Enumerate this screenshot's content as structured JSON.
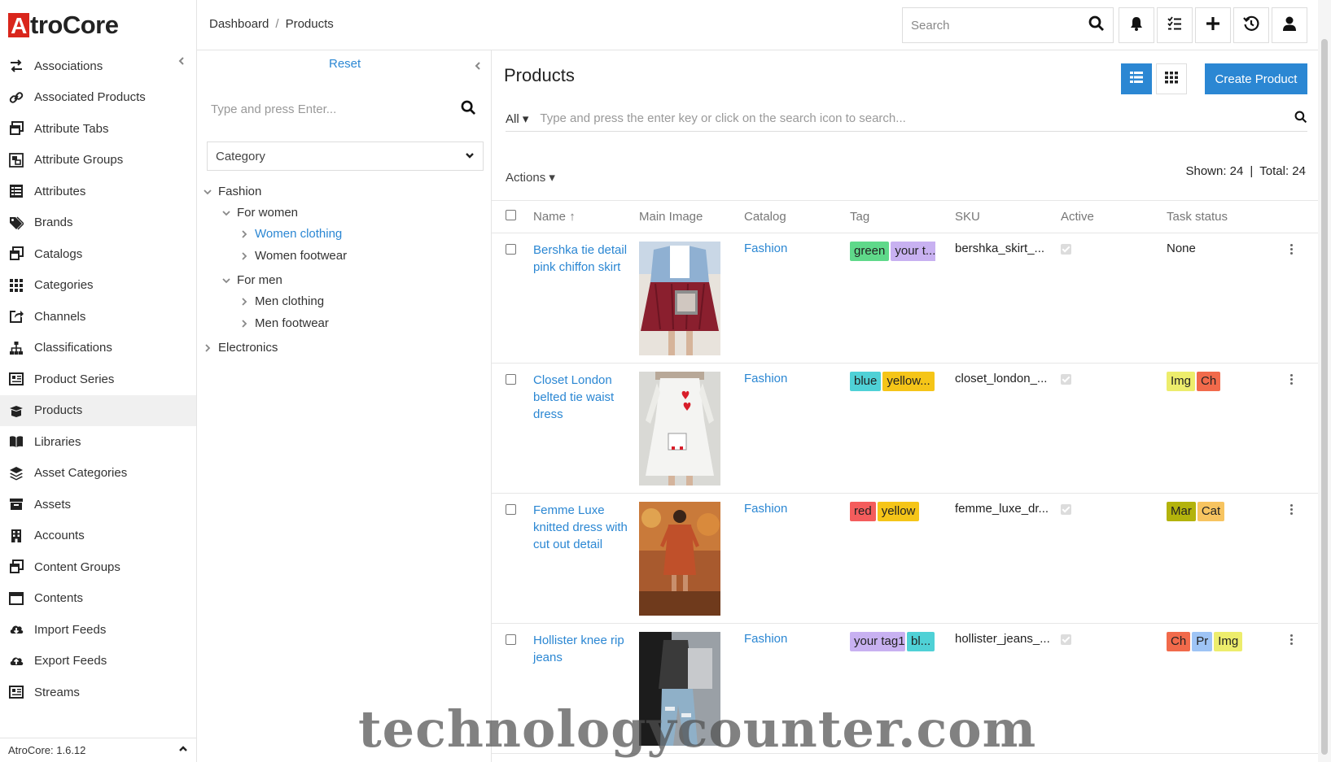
{
  "app": {
    "logo_mark": "A",
    "logo_rest": "troCore",
    "version": "AtroCore: 1.6.12"
  },
  "sidebar": {
    "items": [
      {
        "label": "Associations",
        "icon": "arrows-exchange-icon"
      },
      {
        "label": "Associated Products",
        "icon": "link-icon"
      },
      {
        "label": "Attribute Tabs",
        "icon": "tabs-icon"
      },
      {
        "label": "Attribute Groups",
        "icon": "object-group-icon"
      },
      {
        "label": "Attributes",
        "icon": "list-table-icon"
      },
      {
        "label": "Brands",
        "icon": "tags-icon"
      },
      {
        "label": "Catalogs",
        "icon": "window-restore-icon"
      },
      {
        "label": "Categories",
        "icon": "grid-icon"
      },
      {
        "label": "Channels",
        "icon": "share-square-icon"
      },
      {
        "label": "Classifications",
        "icon": "sitemap-icon"
      },
      {
        "label": "Product Series",
        "icon": "newspaper-icon"
      },
      {
        "label": "Products",
        "icon": "box-open-icon"
      },
      {
        "label": "Libraries",
        "icon": "book-open-icon"
      },
      {
        "label": "Asset Categories",
        "icon": "layer-group-icon"
      },
      {
        "label": "Assets",
        "icon": "archive-icon"
      },
      {
        "label": "Accounts",
        "icon": "building-icon"
      },
      {
        "label": "Content Groups",
        "icon": "window-restore-icon"
      },
      {
        "label": "Contents",
        "icon": "window-icon"
      },
      {
        "label": "Import Feeds",
        "icon": "cloud-download-icon"
      },
      {
        "label": "Export Feeds",
        "icon": "cloud-upload-icon"
      },
      {
        "label": "Streams",
        "icon": "newspaper-icon"
      }
    ]
  },
  "header": {
    "breadcrumb": [
      "Dashboard",
      "Products"
    ],
    "search_placeholder": "Search"
  },
  "filters": {
    "reset_label": "Reset",
    "search_placeholder": "Type and press Enter...",
    "category_select": "Category",
    "tree": {
      "fashion": "Fashion",
      "for_women": "For women",
      "women_clothing": "Women clothing",
      "women_footwear": "Women footwear",
      "for_men": "For men",
      "men_clothing": "Men clothing",
      "men_footwear": "Men footwear",
      "electronics": "Electronics"
    }
  },
  "main": {
    "title": "Products",
    "create_label": "Create Product",
    "filter_all": "All",
    "filter_placeholder": "Type and press the enter key or click on the search icon to search...",
    "actions_label": "Actions",
    "shown_label": "Shown: 24",
    "total_label": "Total: 24",
    "columns": {
      "name": "Name",
      "main_image": "Main Image",
      "catalog": "Catalog",
      "tag": "Tag",
      "sku": "SKU",
      "active": "Active",
      "task_status": "Task status"
    },
    "rows": [
      {
        "name": "Bershka tie detail pink chiffon skirt",
        "catalog": "Fashion",
        "tags": [
          {
            "label": "green",
            "color": "#5fd98a"
          },
          {
            "label": "your t...",
            "color": "#c8b1f1"
          }
        ],
        "sku": "bershka_skirt_...",
        "task_none": "None",
        "task_tags": []
      },
      {
        "name": "Closet London belted tie waist dress",
        "catalog": "Fashion",
        "tags": [
          {
            "label": "blue",
            "color": "#4fd1d6"
          },
          {
            "label": "yellow...",
            "color": "#f5c518"
          },
          {
            "label": "",
            "color": "#e6e60b"
          }
        ],
        "sku": "closet_london_...",
        "task_none": "",
        "task_tags": [
          {
            "label": "Img",
            "color": "#eded6c"
          },
          {
            "label": "Ch",
            "color": "#f16a4b"
          }
        ]
      },
      {
        "name": "Femme Luxe knitted dress with cut out detail",
        "catalog": "Fashion",
        "tags": [
          {
            "label": "red",
            "color": "#f45c5c"
          },
          {
            "label": "yellow",
            "color": "#f5c518"
          }
        ],
        "sku": "femme_luxe_dr...",
        "task_none": "",
        "task_tags": [
          {
            "label": "Mar",
            "color": "#b3b30c"
          },
          {
            "label": "Cat",
            "color": "#f7c460"
          }
        ]
      },
      {
        "name": "Hollister knee rip jeans",
        "catalog": "Fashion",
        "tags": [
          {
            "label": "your tag1",
            "color": "#c8b1f1"
          },
          {
            "label": "bl...",
            "color": "#4fd1d6"
          }
        ],
        "sku": "hollister_jeans_...",
        "task_none": "",
        "task_tags": [
          {
            "label": "Ch",
            "color": "#f16a4b"
          },
          {
            "label": "Pr",
            "color": "#9ec4f5"
          },
          {
            "label": "Img",
            "color": "#eded6c"
          }
        ]
      }
    ]
  },
  "watermark": "technologycounter.com",
  "colors": {
    "accent": "#2b87d3",
    "brand_red": "#d9261c"
  }
}
